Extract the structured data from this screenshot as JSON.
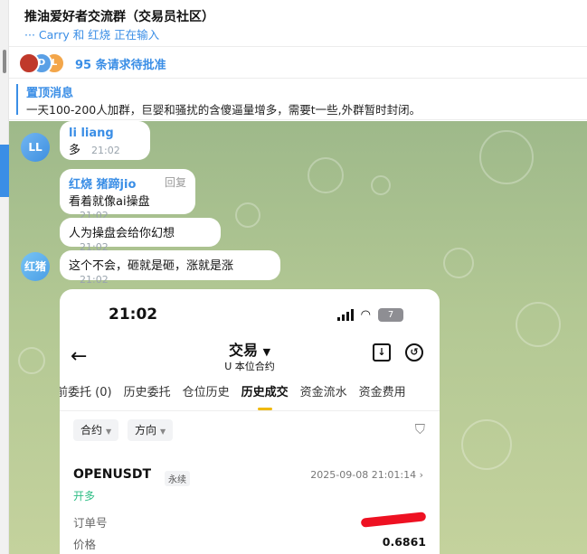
{
  "chat": {
    "title": "推油爱好者交流群（交易员社区）",
    "typing": "··· Carry 和 红烧 正在输入"
  },
  "join_requests": {
    "text": "95 条请求待批准",
    "avatars": [
      "",
      "D",
      "L"
    ]
  },
  "pinned": {
    "title": "置顶消息",
    "text": "一天100-200人加群，巨婴和骚扰的含傻逼量增多，需要t一些,外群暂时封闭。"
  },
  "messages": [
    {
      "avatar": "LL",
      "sender": "li liang",
      "text": "多",
      "time": "21:02"
    },
    {
      "sender": "红烧 猪蹄jio",
      "reply": "回复",
      "text": "看着就像ai操盘",
      "time": "21:02"
    },
    {
      "text": "人为操盘会给你幻想",
      "time": "21:02"
    },
    {
      "avatar": "红猪",
      "text": "这个不会，砸就是砸，涨就是涨",
      "time": "21:02"
    }
  ],
  "screenshot": {
    "status_time": "21:02",
    "battery": "7",
    "title": "交易",
    "title_caret": "▼",
    "subtitle": "U 本位合约",
    "tabs": [
      "前委托 (0)",
      "历史委托",
      "仓位历史",
      "历史成交",
      "资金流水",
      "资金费用"
    ],
    "active_tab": "历史成交",
    "filters": [
      "合约",
      "方向"
    ],
    "trade": {
      "pair": "OPENUSDT",
      "type": "永续",
      "side": "开多",
      "datetime": "2025-09-08 21:01:14",
      "order_label": "订单号",
      "price_label": "价格",
      "price": "0.6861"
    }
  },
  "colors": {
    "accent": "#3a8ee6",
    "buy": "#2ebd85",
    "tab_underline": "#f0b90b",
    "redaction": "#ee1122"
  }
}
